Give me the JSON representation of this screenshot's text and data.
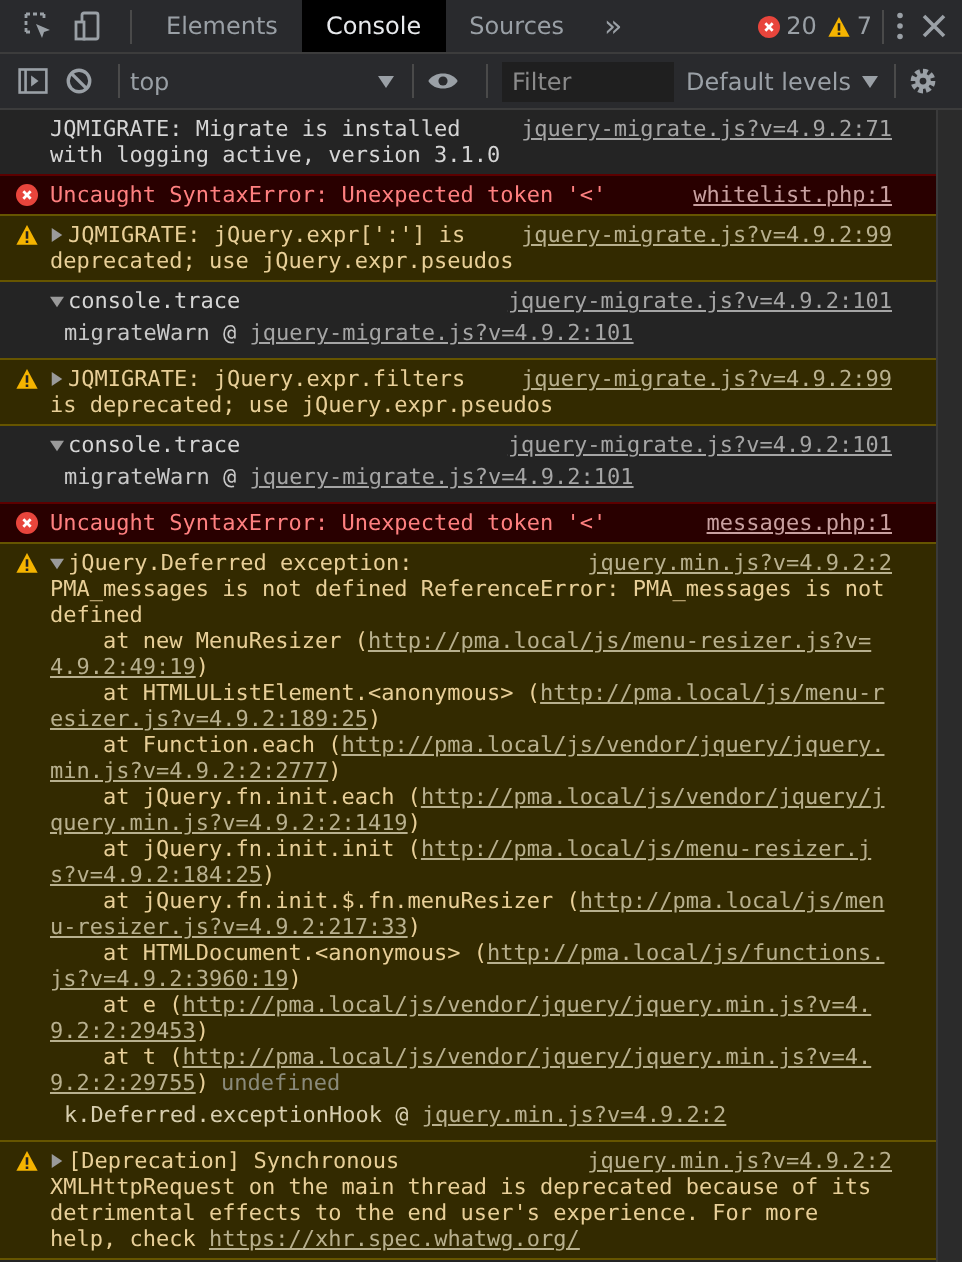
{
  "toolbar": {
    "tabs": [
      {
        "label": "Elements",
        "selected": false
      },
      {
        "label": "Console",
        "selected": true
      },
      {
        "label": "Sources",
        "selected": false
      }
    ],
    "more_tabs": "»",
    "error_count": "20",
    "warning_count": "7"
  },
  "console_toolbar": {
    "context": "top",
    "filter": {
      "placeholder": "Filter"
    },
    "levels": "Default levels"
  },
  "messages": [
    {
      "kind": "log",
      "text": "JQMIGRATE: Migrate is installed",
      "source": "jquery-migrate.js?v=4.9.2:71",
      "lines": [
        [
          {
            "kind": "text",
            "text": "with logging active, version 3.1.0"
          }
        ]
      ]
    },
    {
      "kind": "error",
      "text": "Uncaught SyntaxError: Unexpected token '<'",
      "source": "whitelist.php:1"
    },
    {
      "kind": "warning",
      "expanded": false,
      "text": "JQMIGRATE: jQuery.expr[':'] is",
      "source": "jquery-migrate.js?v=4.9.2:99",
      "lines": [
        [
          {
            "kind": "text",
            "text": "deprecated; use jQuery.expr.pseudos"
          }
        ]
      ]
    },
    {
      "kind": "log",
      "expanded": true,
      "text": "console.trace",
      "source": "jquery-migrate.js?v=4.9.2:101",
      "frames": [
        {
          "function": "migrateWarn",
          "at": "@",
          "source": "jquery-migrate.js?v=4.9.2:101"
        }
      ]
    },
    {
      "kind": "warning",
      "expanded": false,
      "text": "JQMIGRATE: jQuery.expr.filters",
      "source": "jquery-migrate.js?v=4.9.2:99",
      "lines": [
        [
          {
            "kind": "text",
            "text": "is deprecated; use jQuery.expr.pseudos"
          }
        ]
      ]
    },
    {
      "kind": "log",
      "expanded": true,
      "text": "console.trace",
      "source": "jquery-migrate.js?v=4.9.2:101",
      "frames": [
        {
          "function": "migrateWarn",
          "at": "@",
          "source": "jquery-migrate.js?v=4.9.2:101"
        }
      ]
    },
    {
      "kind": "error",
      "text": "Uncaught SyntaxError: Unexpected token '<'",
      "source": "messages.php:1"
    },
    {
      "kind": "warning",
      "expanded": true,
      "text": "jQuery.Deferred exception:",
      "source": "jquery.min.js?v=4.9.2:2",
      "lines": [
        [
          {
            "kind": "text",
            "text": "PMA_messages is not defined ReferenceError: PMA_messages is not"
          }
        ],
        [
          {
            "kind": "text",
            "text": "defined"
          }
        ],
        [
          {
            "kind": "text",
            "text": "    at new MenuResizer ("
          },
          {
            "kind": "link",
            "text": "http://pma.local/js/menu-resizer.js?v="
          }
        ],
        [
          {
            "kind": "link",
            "text": "4.9.2:49:19"
          },
          {
            "kind": "text",
            "text": ")"
          }
        ],
        [
          {
            "kind": "text",
            "text": "    at HTMLUListElement.<anonymous> ("
          },
          {
            "kind": "link",
            "text": "http://pma.local/js/menu-r"
          }
        ],
        [
          {
            "kind": "link",
            "text": "esizer.js?v=4.9.2:189:25"
          },
          {
            "kind": "text",
            "text": ")"
          }
        ],
        [
          {
            "kind": "text",
            "text": "    at Function.each ("
          },
          {
            "kind": "link",
            "text": "http://pma.local/js/vendor/jquery/jquery."
          }
        ],
        [
          {
            "kind": "link",
            "text": "min.js?v=4.9.2:2:2777"
          },
          {
            "kind": "text",
            "text": ")"
          }
        ],
        [
          {
            "kind": "text",
            "text": "    at jQuery.fn.init.each ("
          },
          {
            "kind": "link",
            "text": "http://pma.local/js/vendor/jquery/j"
          }
        ],
        [
          {
            "kind": "link",
            "text": "query.min.js?v=4.9.2:2:1419"
          },
          {
            "kind": "text",
            "text": ")"
          }
        ],
        [
          {
            "kind": "text",
            "text": "    at jQuery.fn.init.init ("
          },
          {
            "kind": "link",
            "text": "http://pma.local/js/menu-resizer.j"
          }
        ],
        [
          {
            "kind": "link",
            "text": "s?v=4.9.2:184:25"
          },
          {
            "kind": "text",
            "text": ")"
          }
        ],
        [
          {
            "kind": "text",
            "text": "    at jQuery.fn.init.$.fn.menuResizer ("
          },
          {
            "kind": "link",
            "text": "http://pma.local/js/men"
          }
        ],
        [
          {
            "kind": "link",
            "text": "u-resizer.js?v=4.9.2:217:33"
          },
          {
            "kind": "text",
            "text": ")"
          }
        ],
        [
          {
            "kind": "text",
            "text": "    at HTMLDocument.<anonymous> ("
          },
          {
            "kind": "link",
            "text": "http://pma.local/js/functions."
          }
        ],
        [
          {
            "kind": "link",
            "text": "js?v=4.9.2:3960:19"
          },
          {
            "kind": "text",
            "text": ")"
          }
        ],
        [
          {
            "kind": "text",
            "text": "    at e ("
          },
          {
            "kind": "link",
            "text": "http://pma.local/js/vendor/jquery/jquery.min.js?v=4."
          }
        ],
        [
          {
            "kind": "link",
            "text": "9.2:2:29453"
          },
          {
            "kind": "text",
            "text": ")"
          }
        ],
        [
          {
            "kind": "text",
            "text": "    at t ("
          },
          {
            "kind": "link",
            "text": "http://pma.local/js/vendor/jquery/jquery.min.js?v=4."
          }
        ],
        [
          {
            "kind": "link",
            "text": "9.2:2:29755"
          },
          {
            "kind": "text",
            "text": ")"
          },
          {
            "kind": "muted",
            "text": "undefined"
          }
        ]
      ],
      "frames": [
        {
          "function": "k.Deferred.exceptionHook",
          "at": "@",
          "source": "jquery.min.js?v=4.9.2:2"
        }
      ]
    },
    {
      "kind": "warning",
      "expanded": false,
      "text": "[Deprecation] Synchronous",
      "source": "jquery.min.js?v=4.9.2:2",
      "lines": [
        [
          {
            "kind": "text",
            "text": "XMLHttpRequest on the main thread is deprecated because of its"
          }
        ],
        [
          {
            "kind": "text",
            "text": "detrimental effects to the end user's experience. For more"
          }
        ],
        [
          {
            "kind": "text",
            "text": "help, check "
          },
          {
            "kind": "link",
            "text": "https://xhr.spec.whatwg.org/"
          }
        ]
      ]
    }
  ]
}
